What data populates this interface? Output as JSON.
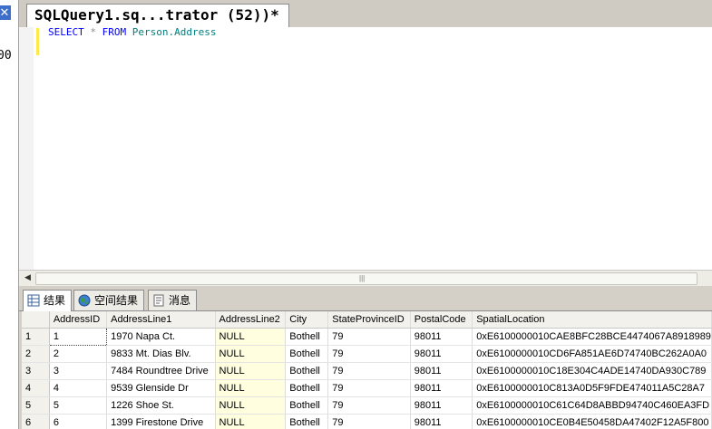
{
  "left_panel": {
    "close_glyph": "✕",
    "cut_text": "00"
  },
  "document_tab": {
    "title": "SQLQuery1.sq...trator (52))*"
  },
  "editor": {
    "sql": {
      "select": "SELECT",
      "star": "*",
      "from": "FROM",
      "table": "Person.Address"
    }
  },
  "scrollbar": {
    "grip": "|||"
  },
  "results_tabs": [
    {
      "label": "结果",
      "icon": "grid-icon",
      "active": true
    },
    {
      "label": "空间结果",
      "icon": "globe-icon",
      "active": false
    },
    {
      "label": "消息",
      "icon": "messages-icon",
      "active": false
    }
  ],
  "grid": {
    "columns": [
      "AddressID",
      "AddressLine1",
      "AddressLine2",
      "City",
      "StateProvinceID",
      "PostalCode",
      "SpatialLocation"
    ],
    "rows": [
      {
        "n": "1",
        "cells": [
          "1",
          "1970 Napa Ct.",
          "NULL",
          "Bothell",
          "79",
          "98011",
          "0xE6100000010CAE8BFC28BCE4474067A8918989"
        ]
      },
      {
        "n": "2",
        "cells": [
          "2",
          "9833 Mt. Dias Blv.",
          "NULL",
          "Bothell",
          "79",
          "98011",
          "0xE6100000010CD6FA851AE6D74740BC262A0A0"
        ]
      },
      {
        "n": "3",
        "cells": [
          "3",
          "7484 Roundtree Drive",
          "NULL",
          "Bothell",
          "79",
          "98011",
          "0xE6100000010C18E304C4ADE14740DA930C789"
        ]
      },
      {
        "n": "4",
        "cells": [
          "4",
          "9539 Glenside Dr",
          "NULL",
          "Bothell",
          "79",
          "98011",
          "0xE6100000010C813A0D5F9FDE474011A5C28A7"
        ]
      },
      {
        "n": "5",
        "cells": [
          "5",
          "1226 Shoe St.",
          "NULL",
          "Bothell",
          "79",
          "98011",
          "0xE6100000010C61C64D8ABBD94740C460EA3FD"
        ]
      },
      {
        "n": "6",
        "cells": [
          "6",
          "1399 Firestone Drive",
          "NULL",
          "Bothell",
          "79",
          "98011",
          "0xE6100000010CE0B4E50458DA47402F12A5F800"
        ]
      }
    ]
  },
  "colors": {
    "editor_change_bar": "#ffe84a",
    "keyword": "#0000ff",
    "object": "#008080",
    "null_cell_bg": "#ffffe0"
  }
}
